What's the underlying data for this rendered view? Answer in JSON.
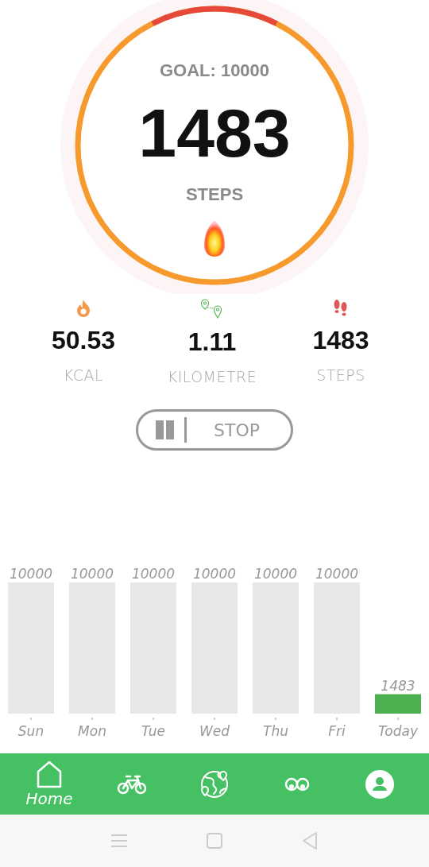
{
  "ring": {
    "goal_label": "GOAL: 10000",
    "steps": "1483",
    "steps_label": "STEPS"
  },
  "stats": [
    {
      "kind": "calories",
      "value": "50.53",
      "label": "KCAL"
    },
    {
      "kind": "distance",
      "value": "1.11",
      "label": "KILOMETRE"
    },
    {
      "kind": "steps",
      "value": "1483",
      "label": "STEPS"
    }
  ],
  "stop_button": {
    "label": "STOP"
  },
  "chart_data": {
    "type": "bar",
    "categories": [
      "Sun",
      "Mon",
      "Tue",
      "Wed",
      "Thu",
      "Fri",
      "Today"
    ],
    "stacked": true,
    "data_labels": true,
    "series": [
      {
        "color": "#e6e8e6",
        "values": [
          10000,
          10000,
          10000,
          10000,
          10000,
          10000,
          null
        ]
      },
      {
        "color": "#4caf50",
        "values": [
          null,
          null,
          null,
          null,
          null,
          null,
          1483
        ]
      }
    ]
  },
  "nav": [
    {
      "kind": "home",
      "label": "Home"
    },
    {
      "kind": "bike"
    },
    {
      "kind": "globe"
    },
    {
      "kind": "glasses"
    },
    {
      "kind": "profile"
    }
  ]
}
